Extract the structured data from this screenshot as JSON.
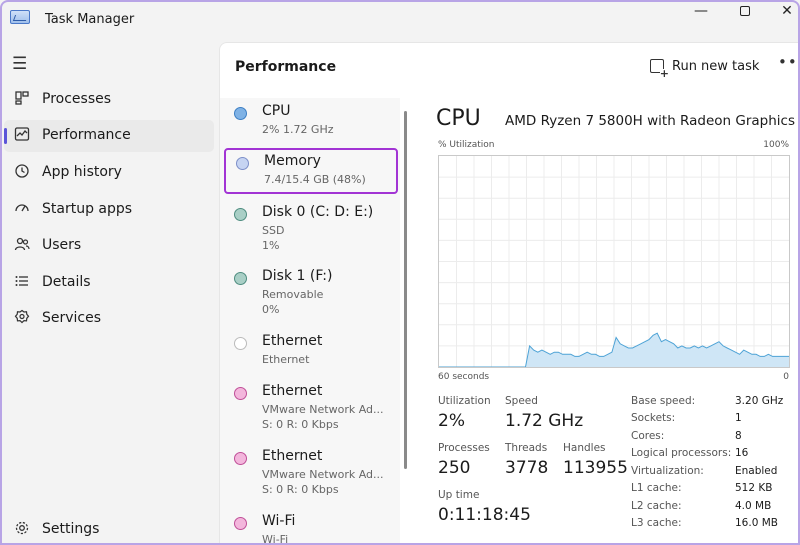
{
  "window": {
    "title": "Task Manager",
    "minimize_glyph": "—",
    "close_glyph": "✕"
  },
  "sidebar": {
    "items": [
      {
        "label": "Processes",
        "icon": "processes-icon"
      },
      {
        "label": "Performance",
        "icon": "performance-icon"
      },
      {
        "label": "App history",
        "icon": "app-history-icon"
      },
      {
        "label": "Startup apps",
        "icon": "startup-apps-icon"
      },
      {
        "label": "Users",
        "icon": "users-icon"
      },
      {
        "label": "Details",
        "icon": "details-icon"
      },
      {
        "label": "Services",
        "icon": "services-icon"
      }
    ],
    "settings_label": "Settings"
  },
  "header": {
    "title": "Performance",
    "run_new_task": "Run new task"
  },
  "devices": [
    {
      "name": "CPU",
      "line1": "2%  1.72 GHz",
      "line2": "",
      "dot_color": "#7fb2e5",
      "dot_border": "#3d7fc4"
    },
    {
      "name": "Memory",
      "line1": "7.4/15.4 GB (48%)",
      "line2": "",
      "dot_color": "#c6d4f2",
      "dot_border": "#7d8fc9"
    },
    {
      "name": "Disk 0 (C: D: E:)",
      "line1": "SSD",
      "line2": "1%",
      "dot_color": "#a9cfc6",
      "dot_border": "#4f8d80"
    },
    {
      "name": "Disk 1 (F:)",
      "line1": "Removable",
      "line2": "0%",
      "dot_color": "#a9cfc6",
      "dot_border": "#4f8d80"
    },
    {
      "name": "Ethernet",
      "line1": "Ethernet",
      "line2": "",
      "dot_color": "#ffffff",
      "dot_border": "#bbbbbb"
    },
    {
      "name": "Ethernet",
      "line1": "VMware Network Ad...",
      "line2": "S: 0  R: 0 Kbps",
      "dot_color": "#f3b6dc",
      "dot_border": "#c04f98"
    },
    {
      "name": "Ethernet",
      "line1": "VMware Network Ad...",
      "line2": "S: 0  R: 0 Kbps",
      "dot_color": "#f3b6dc",
      "dot_border": "#c04f98"
    },
    {
      "name": "Wi-Fi",
      "line1": "Wi-Fi",
      "line2": "",
      "dot_color": "#f3b6dc",
      "dot_border": "#c04f98"
    }
  ],
  "cpu": {
    "heading": "CPU",
    "model": "AMD Ryzen 7 5800H with Radeon Graphics",
    "util_label": "% Utilization",
    "util_max": "100%",
    "axis_left": "60 seconds",
    "axis_right": "0",
    "graph_line_color": "#4ea3d6",
    "graph_fill_color": "#cfe6f6",
    "graph_values": [
      0,
      0,
      0,
      0,
      0,
      0,
      0,
      0,
      0,
      0,
      0,
      0,
      0,
      0,
      0,
      0,
      0,
      0,
      0,
      0,
      0,
      0,
      10,
      8,
      7,
      8,
      7,
      6,
      7,
      7,
      6,
      6,
      6,
      5,
      5,
      6,
      7,
      6,
      6,
      5,
      5,
      6,
      7,
      14,
      11,
      10,
      9,
      9,
      10,
      11,
      12,
      13,
      15,
      16,
      12,
      13,
      12,
      11,
      9,
      10,
      9,
      9,
      10,
      9,
      10,
      9,
      10,
      11,
      12,
      10,
      9,
      8,
      7,
      6,
      8,
      7,
      6,
      6,
      5,
      5,
      6,
      5,
      5,
      5,
      5,
      5
    ],
    "stats": {
      "utilization_label": "Utilization",
      "utilization": "2%",
      "speed_label": "Speed",
      "speed": "1.72 GHz",
      "processes_label": "Processes",
      "processes": "250",
      "threads_label": "Threads",
      "threads": "3778",
      "handles_label": "Handles",
      "handles": "113955",
      "uptime_label": "Up time",
      "uptime": "0:11:18:45"
    },
    "specs": [
      {
        "label": "Base speed:",
        "value": "3.20 GHz"
      },
      {
        "label": "Sockets:",
        "value": "1"
      },
      {
        "label": "Cores:",
        "value": "8"
      },
      {
        "label": "Logical processors:",
        "value": "16"
      },
      {
        "label": "Virtualization:",
        "value": "Enabled"
      },
      {
        "label": "L1 cache:",
        "value": "512 KB"
      },
      {
        "label": "L2 cache:",
        "value": "4.0 MB"
      },
      {
        "label": "L3 cache:",
        "value": "16.0 MB"
      }
    ]
  }
}
